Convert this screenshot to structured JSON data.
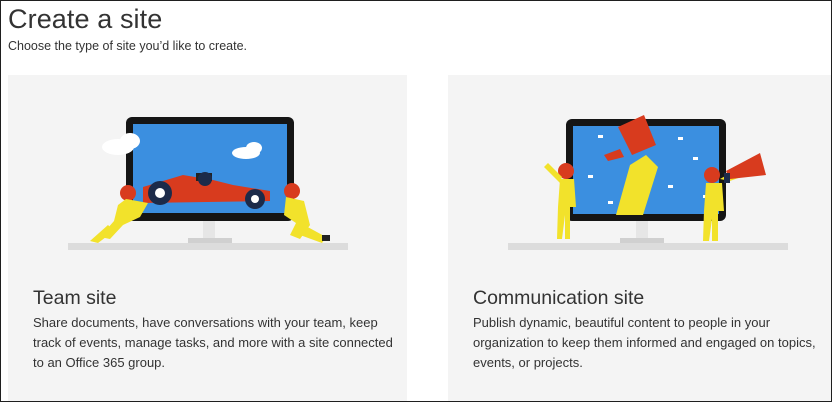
{
  "page": {
    "title": "Create a site",
    "subtitle": "Choose the type of site you’d like to create."
  },
  "cards": [
    {
      "title": "Team site",
      "description": "Share documents, have conversations with your team, keep track of events, manage tasks, and more with a site connected to an Office 365 group.",
      "illustration": "race-car-pit-crew-illustration"
    },
    {
      "title": "Communication site",
      "description": "Publish dynamic, beautiful content to people in your organization to keep them informed and engaged on topics, events, or projects.",
      "illustration": "trophy-megaphone-illustration"
    }
  ],
  "colors": {
    "card_background": "#f4f4f4",
    "screen_blue": "#3b8fe0",
    "monitor_black": "#151515",
    "figure_yellow": "#f2e22b",
    "helmet_red": "#d83b1e",
    "text": "#333333"
  }
}
